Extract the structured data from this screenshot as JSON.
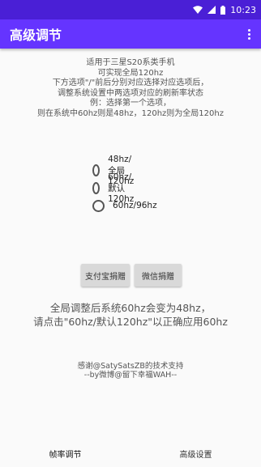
{
  "status_bar": {
    "time": "10:23",
    "icons": [
      "wifi-icon",
      "signal-icon",
      "battery-icon"
    ]
  },
  "app_bar": {
    "title": "高级调节",
    "menu_icon": "more-vert-icon"
  },
  "description": {
    "lines": [
      "适用于三星S20系类手机",
      "可实现全局120hz",
      "下方选项\"/\"前后分别对应选择对应选项后，",
      "调整系统设置中两选项对应的刷新率状态",
      "例：选择第一个选项，",
      "则在系统中60hz则是48hz，120hz则为全局120hz"
    ]
  },
  "options": [
    {
      "label": "48hz/全局120hz",
      "selected": false
    },
    {
      "label": "60hz/默认120hz",
      "selected": false
    },
    {
      "label": "60hz/96hz",
      "selected": false
    }
  ],
  "buttons": {
    "alipay": "支付宝捐赠",
    "wechat": "微信捐赠"
  },
  "notice": {
    "line1": "全局调整后系统60hz会变为48hz，",
    "line2": "请点击\"60hz/默认120hz\"以正确应用60hz"
  },
  "credits": {
    "line1": "感谢@SatySatsZB的技术支持",
    "line2": "--by微博@留下幸福WAH--"
  },
  "tabs": [
    {
      "label": "帧率调节",
      "active": true
    },
    {
      "label": "高级设置",
      "active": false
    }
  ],
  "colors": {
    "status_bar": "#4a1fd6",
    "app_bar": "#6534ff",
    "background": "#fafafa",
    "button": "#d9d9d9"
  }
}
